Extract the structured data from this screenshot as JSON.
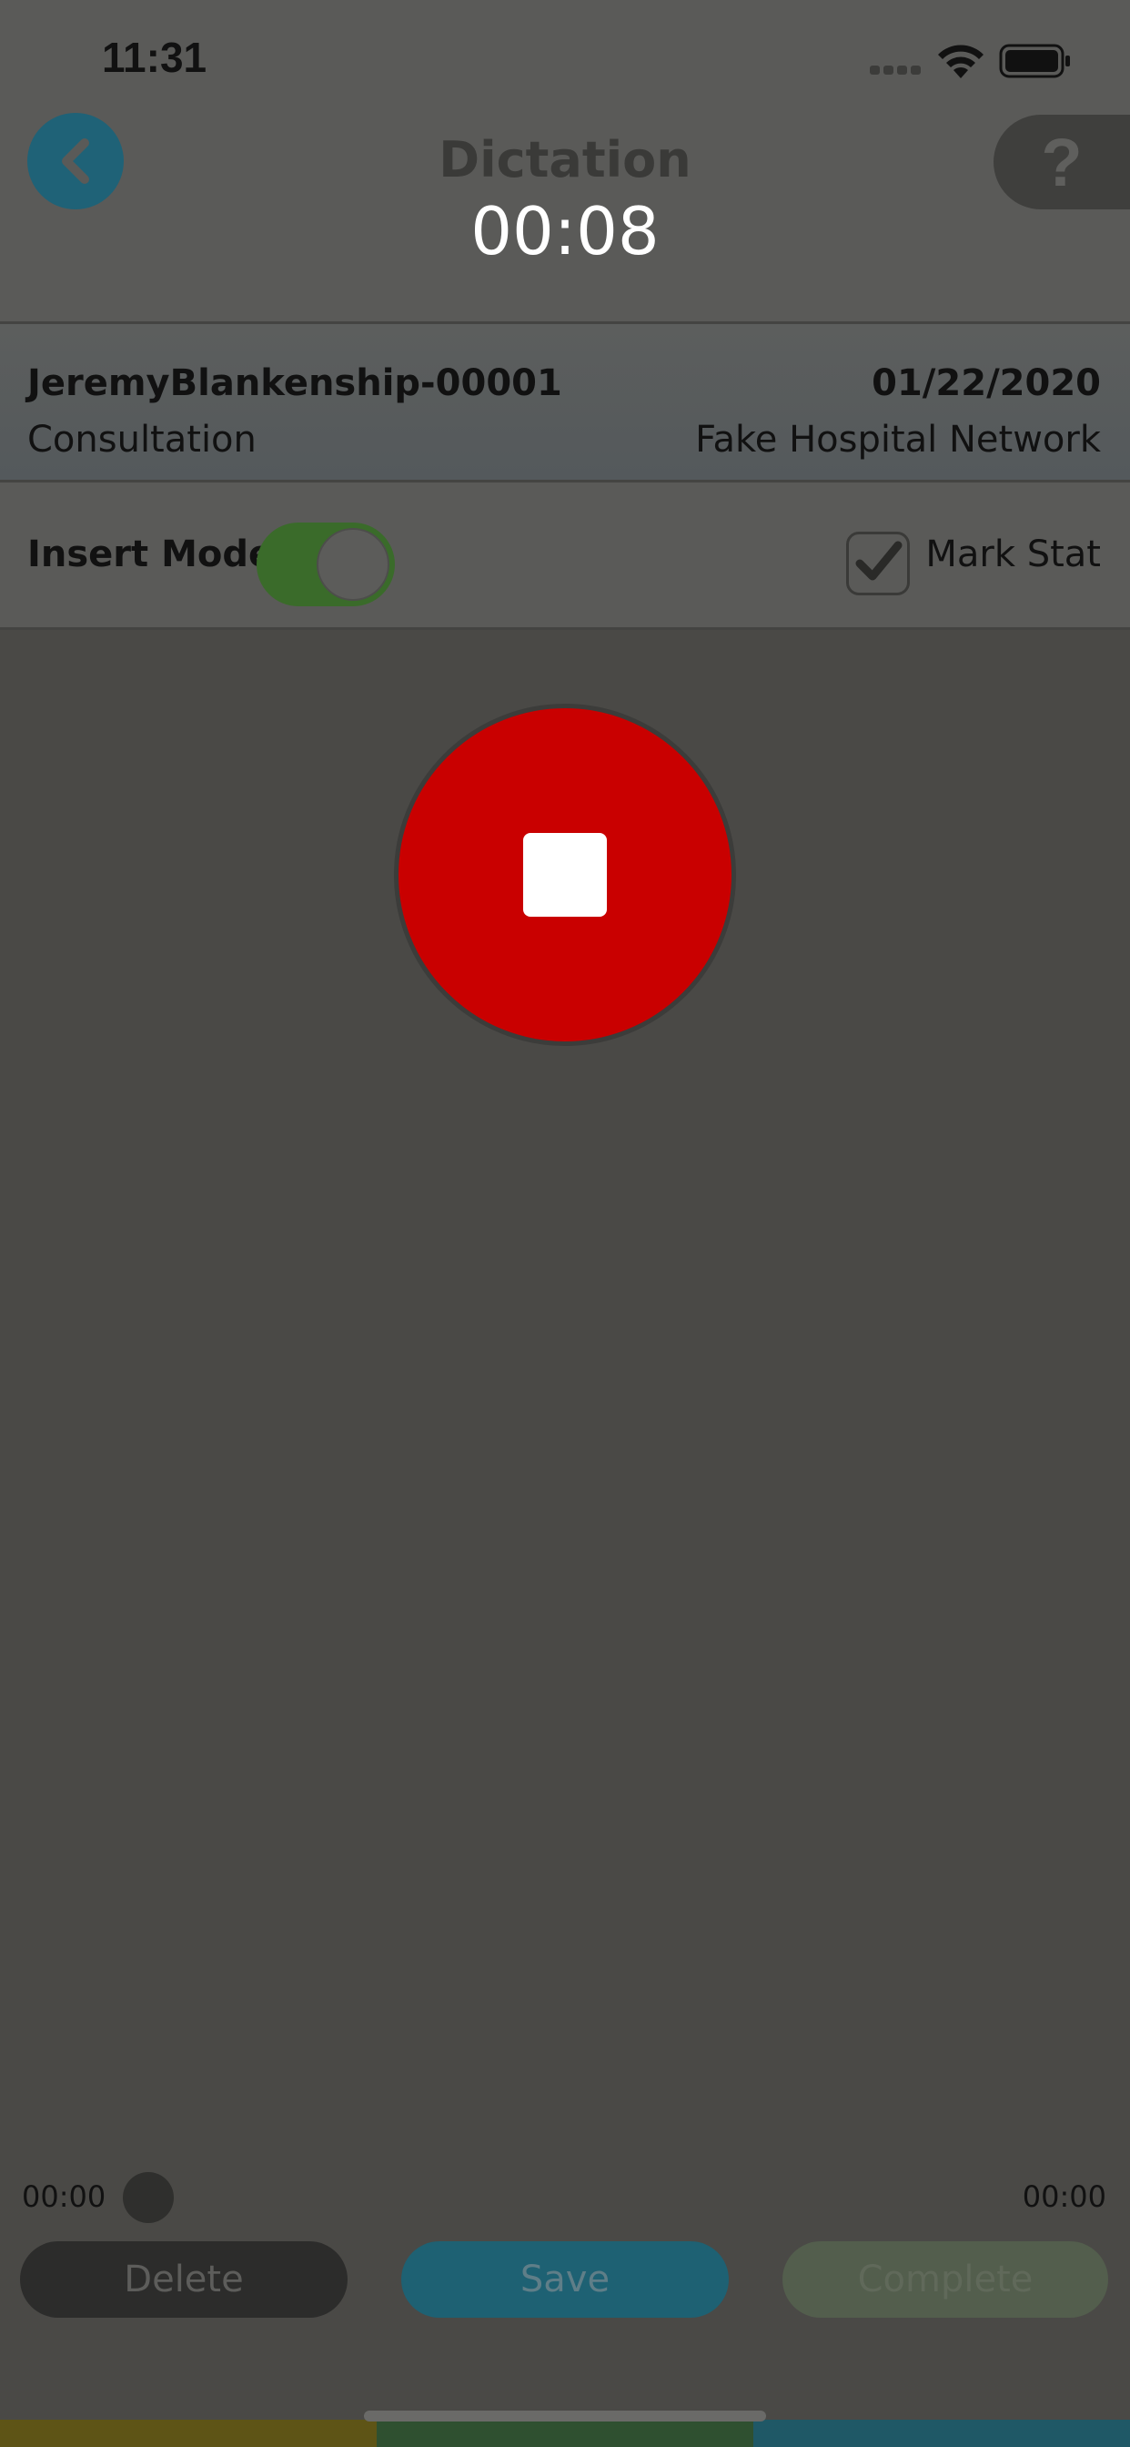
{
  "status_bar": {
    "time": "11:31",
    "icons": [
      "signal-dots-icon",
      "wifi-icon",
      "battery-icon"
    ]
  },
  "header": {
    "title": "Dictation",
    "timer": "00:08",
    "back_icon": "chevron-left-icon",
    "help_label": "?"
  },
  "info": {
    "patient_id": "JeremyBlankenship-00001",
    "date": "01/22/2020",
    "visit_type": "Consultation",
    "hospital": "Fake Hospital Network"
  },
  "options": {
    "insert_mode_label": "Insert Mode",
    "insert_mode_on": true,
    "mark_stat_label": "Mark Stat",
    "mark_stat_checked": true
  },
  "recorder": {
    "state": "recording",
    "icon": "stop-icon"
  },
  "playback": {
    "current_time": "00:00",
    "total_time": "00:00",
    "progress": 0
  },
  "actions": {
    "delete_label": "Delete",
    "save_label": "Save",
    "complete_label": "Complete"
  },
  "colors": {
    "stop_button": "#c90000",
    "back_button": "#1f6277",
    "toggle_on": "#3a6b2a",
    "save_button": "#1e6173"
  }
}
